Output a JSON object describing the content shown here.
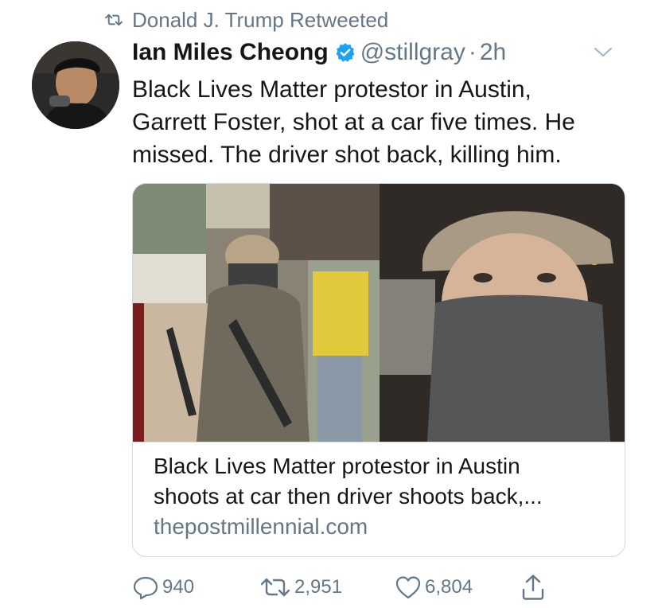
{
  "retweet_banner": {
    "text": "Donald J. Trump Retweeted",
    "icon": "retweet-icon"
  },
  "author": {
    "name": "Ian Miles Cheong",
    "handle": "@stillgray",
    "separator": "·",
    "time": "2h",
    "verified_color": "#1da1f2"
  },
  "tweet": {
    "lines": [
      "Black Lives Matter protestor in Austin,",
      "Garrett Foster, shot at a car five times. He",
      "missed. The driver shot back, killing him."
    ]
  },
  "card": {
    "title_lines": [
      "Black Lives Matter protestor in Austin",
      "shoots at car then driver shoots back,..."
    ],
    "domain": "thepostmillennial.com"
  },
  "actions": {
    "replies": "940",
    "retweets": "2,951",
    "likes": "6,804"
  },
  "colors": {
    "secondary_text": "#657786",
    "primary_text": "#14171a",
    "border": "#cfd9de"
  }
}
